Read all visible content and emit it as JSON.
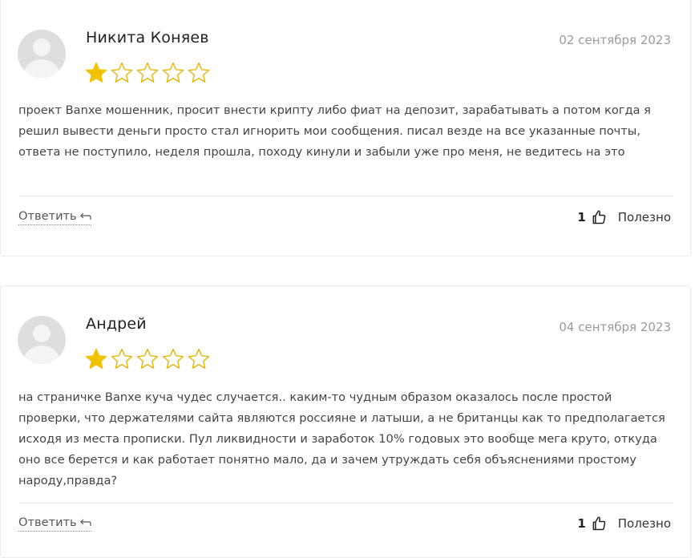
{
  "reviews": [
    {
      "author": "Никита Коняев",
      "date": "02 сентября 2023",
      "rating": 1,
      "max_rating": 5,
      "text": "проект Banxe мошенник, просит внести крипту либо фиат на депозит, зарабатывать а потом когда я решил вывести деньги просто стал игнорить мои сообщения. писал везде на все указанные почты, ответа не поступило, неделя прошла, походу кинули и забыли уже про меня, не ведитесь на это",
      "reply_label": "Ответить",
      "helpful_count": "1",
      "helpful_label": "Полезно"
    },
    {
      "author": "Андрей",
      "date": "04 сентября 2023",
      "rating": 1,
      "max_rating": 5,
      "text": "на страничке Banxe куча чудес случается.. каким-то чудным образом оказалось после простой проверки, что держателями сайта являются россияне и латыши, а не британцы как то предполагается исходя из места прописки. Пул ликвидности и заработок 10% годовых это вообще мега круто, откуда оно все берется и как работает понятно мало, да и зачем утруждать себя объяснениями простому народу,правда?",
      "reply_label": "Ответить",
      "helpful_count": "1",
      "helpful_label": "Полезно"
    }
  ],
  "colors": {
    "star_filled": "#f2c200",
    "star_empty_stroke": "#e0b400"
  }
}
